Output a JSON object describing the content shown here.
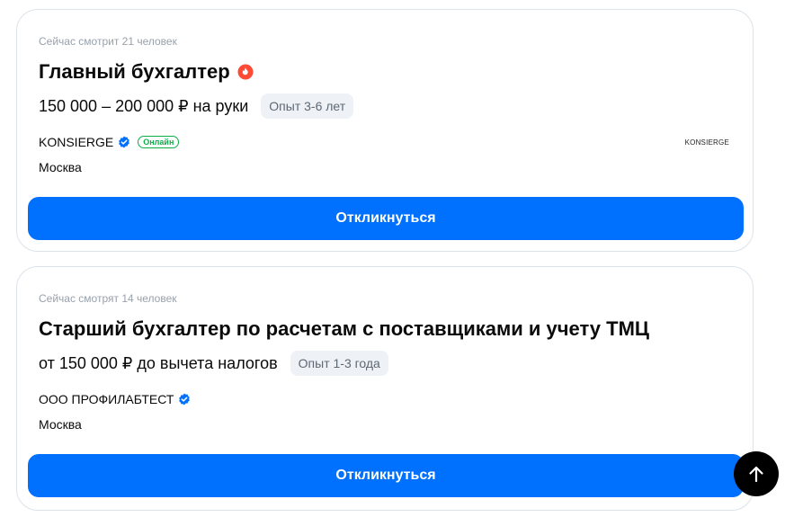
{
  "vacancies": [
    {
      "viewers": "Сейчас смотрит 21 человек",
      "title": "Главный бухгалтер",
      "hot_icon": "fire-icon",
      "salary": "150 000 – 200 000 ₽ на руки",
      "experience": "Опыт 3-6 лет",
      "company": "KONSIERGE",
      "verified_icon": "verified-check-icon",
      "online_badge": "Онлайн",
      "city": "Москва",
      "logo_text": "KONSIERGE",
      "apply_label": "Откликнуться"
    },
    {
      "viewers": "Сейчас смотрят 14 человек",
      "title": "Старший бухгалтер по расчетам с поставщиками и учету ТМЦ",
      "salary": "от 150 000 ₽ до вычета налогов",
      "experience": "Опыт 1-3 года",
      "company": "ООО ПРОФИЛАБТЕСТ",
      "verified_icon": "verified-check-icon",
      "city": "Москва",
      "apply_label": "Откликнуться"
    }
  ],
  "scroll_top_icon": "arrow-up-icon",
  "colors": {
    "accent": "#0070ff",
    "online": "#0dae4a",
    "fire": "#ff4a35",
    "muted": "#98a1ab"
  }
}
